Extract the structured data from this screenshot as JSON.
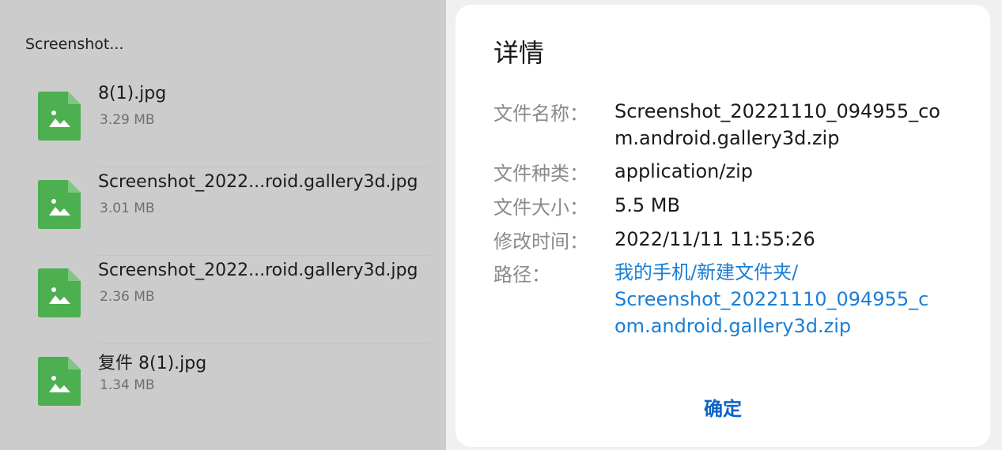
{
  "file_list": {
    "folder_label": "Screenshot...",
    "items": [
      {
        "name": "8(1).jpg",
        "size": "3.29 MB",
        "icon": "image-file-icon"
      },
      {
        "name": "Screenshot_2022...roid.gallery3d.jpg",
        "size": "3.01 MB",
        "icon": "image-file-icon"
      },
      {
        "name": "Screenshot_2022...roid.gallery3d.jpg",
        "size": "2.36 MB",
        "icon": "image-file-icon"
      },
      {
        "name": "复件 8(1).jpg",
        "size": "1.34 MB",
        "icon": "image-file-icon"
      }
    ]
  },
  "dialog": {
    "title": "详情",
    "rows": [
      {
        "label": "文件名称：",
        "value": "Screenshot_20221110_094955_com.android.gallery3d.zip"
      },
      {
        "label": "文件种类：",
        "value": "application/zip"
      },
      {
        "label": "文件大小：",
        "value": "5.5 MB"
      },
      {
        "label": "修改时间：",
        "value": "2022/11/11 11:55:26"
      },
      {
        "label": "路径：",
        "value_lines": [
          "我的手机/新建文件夹/",
          "Screenshot_20221110_094955_c",
          "om.android.gallery3d.zip"
        ]
      }
    ],
    "confirm_label": "确定"
  },
  "colors": {
    "icon_green": "#4caf50",
    "link_blue": "#1a7fd6",
    "confirm_blue": "#0a63c7"
  }
}
